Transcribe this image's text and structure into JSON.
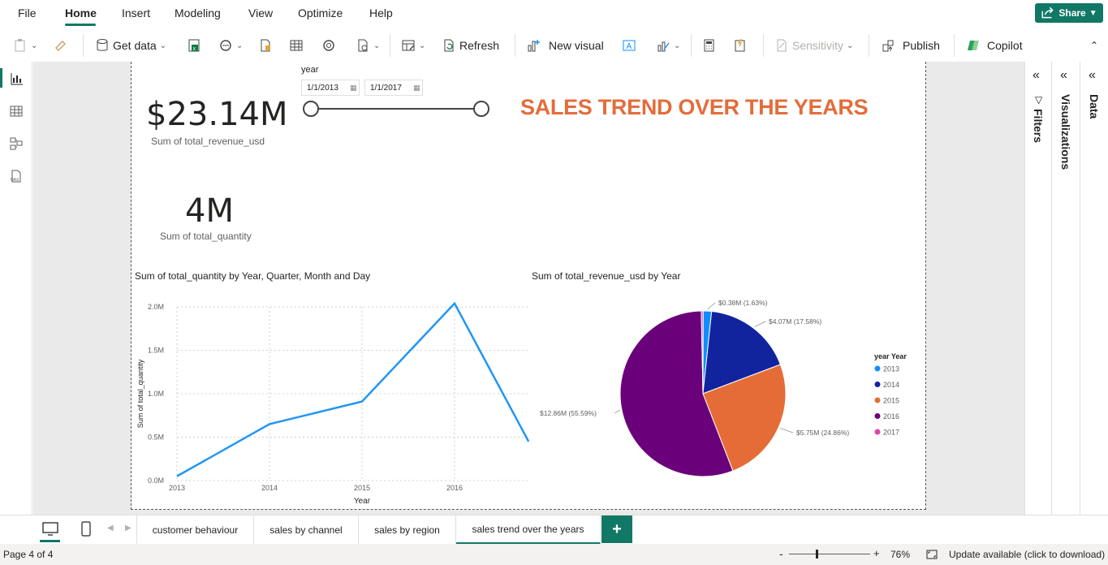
{
  "menu": {
    "items": [
      "File",
      "Home",
      "Insert",
      "Modeling",
      "View",
      "Optimize",
      "Help"
    ],
    "active": "Home",
    "share_label": "Share"
  },
  "ribbon": {
    "get_data": "Get data",
    "refresh": "Refresh",
    "new_visual": "New visual",
    "sensitivity": "Sensitivity",
    "publish": "Publish",
    "copilot": "Copilot"
  },
  "panes": {
    "filters": "Filters",
    "visualizations": "Visualizations",
    "data": "Data"
  },
  "report": {
    "title": "SALES TREND OVER THE YEARS",
    "title_color": "#E46C3A",
    "card_revenue": {
      "value": "$23.14M",
      "label": "Sum of total_revenue_usd"
    },
    "card_quantity": {
      "value": "4M",
      "label": "Sum of total_quantity"
    },
    "slicer": {
      "label": "year",
      "start": "1/1/2013",
      "end": "1/1/2017"
    }
  },
  "chart_data": [
    {
      "type": "line",
      "title": "Sum of total_quantity by Year, Quarter, Month and Day",
      "xlabel": "Year",
      "ylabel": "Sum of total_quantity",
      "x": [
        2013,
        2014,
        2015,
        2016,
        2016.8
      ],
      "x_ticks": [
        "2013",
        "2014",
        "2015",
        "2016"
      ],
      "y_ticks": [
        "0.0M",
        "0.5M",
        "1.0M",
        "1.5M",
        "2.0M"
      ],
      "ylim": [
        0,
        2.0
      ],
      "series": [
        {
          "values": [
            0.05,
            0.65,
            0.91,
            2.04,
            0.45
          ],
          "color": "#2196F3"
        }
      ],
      "grid": true
    },
    {
      "type": "pie",
      "title": "Sum of total_revenue_usd by Year",
      "legend_title": "year Year",
      "legend_position": "right",
      "slices": [
        {
          "label": "2013",
          "value": 0.38,
          "display": "$0.38M (1.63%)",
          "color": "#118DFF"
        },
        {
          "label": "2014",
          "value": 4.07,
          "display": "$4.07M (17.58%)",
          "color": "#12239E"
        },
        {
          "label": "2015",
          "value": 5.75,
          "display": "$5.75M (24.86%)",
          "color": "#E66C37"
        },
        {
          "label": "2016",
          "value": 12.86,
          "display": "$12.86M (55.59%)",
          "color": "#6B007B"
        },
        {
          "label": "2017",
          "value": 0.08,
          "display": "",
          "color": "#E044A7"
        }
      ]
    }
  ],
  "tabs": [
    "customer behaviour",
    "sales by channel",
    "sales by region",
    "sales trend over the years"
  ],
  "active_tab": "sales trend over the years",
  "status": {
    "page": "Page 4 of 4",
    "zoom": "76%",
    "update": "Update available (click to download)"
  }
}
